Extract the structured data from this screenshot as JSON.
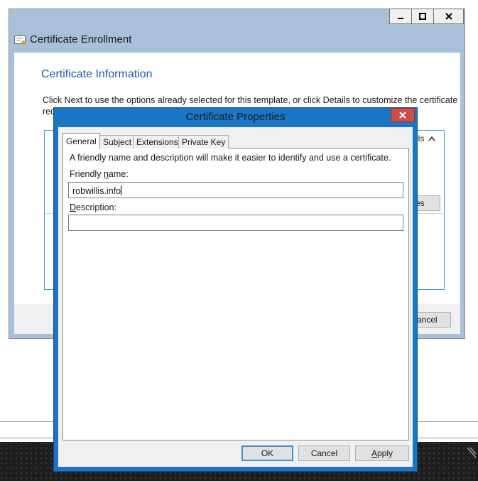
{
  "background_window": {
    "title": "Certificate Enrollment",
    "heading": "Certificate Information",
    "description_line1": "Click Next to use the options already selected for this template, or click Details to customize the certificate",
    "description_line2": "req",
    "details_text": "ils",
    "details_button_fragment": "es",
    "cancel_button_fragment": "ancel"
  },
  "dialog": {
    "title": "Certificate Properties",
    "tabs": [
      "General",
      "Subject",
      "Extensions",
      "Private Key"
    ],
    "active_tab": "General",
    "intro_text": "A friendly name and description will make it easier to identify and use a certificate.",
    "friendly_name_label_pre": "Friendly ",
    "friendly_name_label_u": "n",
    "friendly_name_label_post": "ame:",
    "friendly_name_value": "robwillis.info",
    "description_label_u": "D",
    "description_label_post": "escription:",
    "description_value": "",
    "ok_label": "OK",
    "cancel_label": "Cancel",
    "apply_label_u": "A",
    "apply_label_post": "pply"
  },
  "colors": {
    "dialog_frame": "#1a76c4",
    "close_button": "#c7504d",
    "heading_blue": "#1e5aa8"
  },
  "icons": [
    "certificate-icon",
    "minimize-icon",
    "maximize-icon",
    "close-icon",
    "chevron-up-icon"
  ]
}
